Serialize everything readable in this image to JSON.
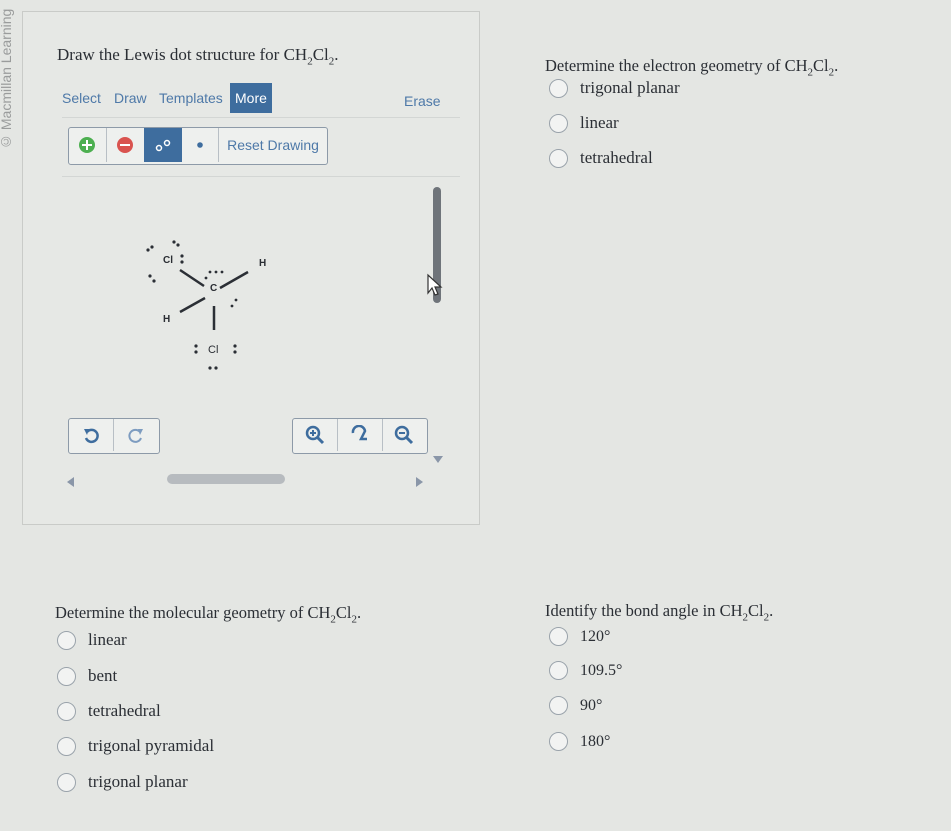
{
  "watermark": "© Macmillan Learning",
  "draw_panel": {
    "prompt_prefix": "Draw the Lewis dot structure for CH",
    "formula_sub1": "2",
    "formula_mid": "Cl",
    "formula_sub2": "2",
    "formula_end": ".",
    "tabs": {
      "select": "Select",
      "draw": "Draw",
      "templates": "Templates",
      "more": "More",
      "erase": "Erase"
    },
    "tools": {
      "reset": "Reset Drawing"
    },
    "atoms": {
      "cl_top": "Cl",
      "c": "C",
      "h_right": "H",
      "h_left": "H",
      "cl_bottom": "Cl"
    }
  },
  "q_electron": {
    "prefix": "Determine the electron geometry of CH",
    "sub1": "2",
    "mid": "Cl",
    "sub2": "2",
    "end": ".",
    "options": [
      "trigonal planar",
      "linear",
      "tetrahedral"
    ]
  },
  "q_molecular": {
    "prefix": "Determine the molecular geometry of CH",
    "sub1": "2",
    "mid": "Cl",
    "sub2": "2",
    "end": ".",
    "options": [
      "linear",
      "bent",
      "tetrahedral",
      "trigonal pyramidal",
      "trigonal planar"
    ]
  },
  "q_angle": {
    "prefix": "Identify the bond angle in CH",
    "sub1": "2",
    "mid": "Cl",
    "sub2": "2",
    "end": ".",
    "options": [
      "120°",
      "109.5°",
      "90°",
      "180°"
    ]
  },
  "colors": {
    "accent": "#3e6d9e",
    "plus": "#4caf50",
    "minus": "#d9534f",
    "link": "#4e79a8"
  }
}
